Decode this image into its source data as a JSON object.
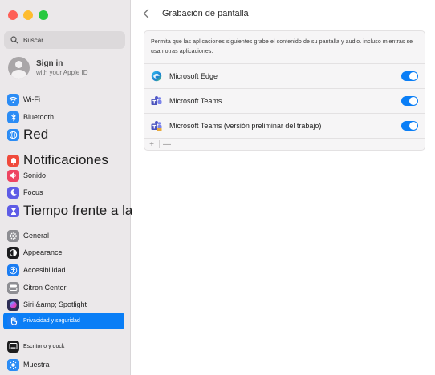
{
  "window": {
    "traffic_lights": {
      "close": "#fe5f57",
      "minimize": "#febc2e",
      "zoom": "#28c840"
    }
  },
  "sidebar": {
    "search_placeholder": "Buscar",
    "account": {
      "title": "Sign in",
      "subtitle": "with your Apple ID"
    },
    "items": [
      {
        "label": "Wi-Fi",
        "icon": "wifi-icon",
        "color": "#2b8cf5"
      },
      {
        "label": "Bluetooth",
        "icon": "bluetooth-icon",
        "color": "#2b8cf5"
      },
      {
        "label": "Red",
        "icon": "globe-icon",
        "color": "#2b8cf5"
      },
      {
        "label": "Notificaciones",
        "icon": "bell-icon",
        "color": "#f04a3c"
      },
      {
        "label": "Sonido",
        "icon": "speaker-icon",
        "color": "#ee4461"
      },
      {
        "label": "Focus",
        "icon": "moon-icon",
        "color": "#5e5ce6"
      },
      {
        "label": "Tiempo frente a la pantalla",
        "icon": "hourglass-icon",
        "color": "#5e5ce6"
      },
      {
        "label": "General",
        "icon": "gear-icon",
        "color": "#8e8e93"
      },
      {
        "label": "Appearance",
        "icon": "appearance-icon",
        "color": "#1c1c1e"
      },
      {
        "label": "Accesibilidad",
        "icon": "accessibility-icon",
        "color": "#1a7cf2"
      },
      {
        "label": "Citron Center",
        "icon": "control-center-icon",
        "color": "#8e8e93"
      },
      {
        "label": "Siri &amp; Spotlight",
        "icon": "siri-icon",
        "color": "#2d2d55"
      },
      {
        "label": "Privacidad y seguridad",
        "icon": "hand-icon",
        "color": "#1a7cf2"
      },
      {
        "label": "Escritorio y dock",
        "icon": "dock-icon",
        "color": "#1c1c1e"
      },
      {
        "label": "Muestra",
        "icon": "display-icon",
        "color": "#2b8cf5"
      }
    ]
  },
  "main": {
    "title": "Grabación de pantalla",
    "description": "Permita que las aplicaciones siguientes grabe el contenido de su pantalla y audio. incluso mientras se usan otras aplicaciones.",
    "apps": [
      {
        "name": "Microsoft Edge",
        "icon": "edge-icon",
        "enabled": true
      },
      {
        "name": "Microsoft Teams",
        "icon": "teams-icon",
        "enabled": true
      },
      {
        "name": "Microsoft Teams (versión preliminar del trabajo)",
        "icon": "teams-preview-icon",
        "enabled": true
      }
    ],
    "add_label": "+",
    "remove_label": "—",
    "accent": "#0a7ef6"
  }
}
